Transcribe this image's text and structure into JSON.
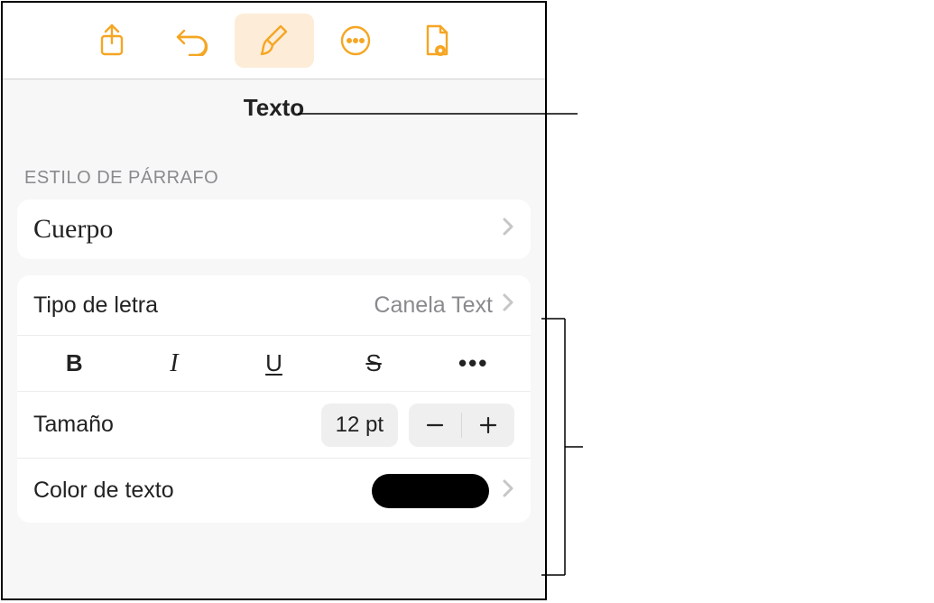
{
  "toolbar": {
    "icons": [
      "share-icon",
      "undo-icon",
      "format-paintbrush-icon",
      "more-icon",
      "document-view-icon"
    ]
  },
  "tab": {
    "title": "Texto"
  },
  "section": {
    "paragraph_style_label": "ESTILO DE PÁRRAFO"
  },
  "paragraph_style": {
    "value": "Cuerpo"
  },
  "font": {
    "label": "Tipo de letra",
    "value": "Canela Text"
  },
  "format_buttons": {
    "bold": "B",
    "italic": "I",
    "underline": "U",
    "strike": "S",
    "more": "•••"
  },
  "size": {
    "label": "Tamaño",
    "value": "12 pt"
  },
  "text_color": {
    "label": "Color de texto",
    "value": "#000000"
  }
}
